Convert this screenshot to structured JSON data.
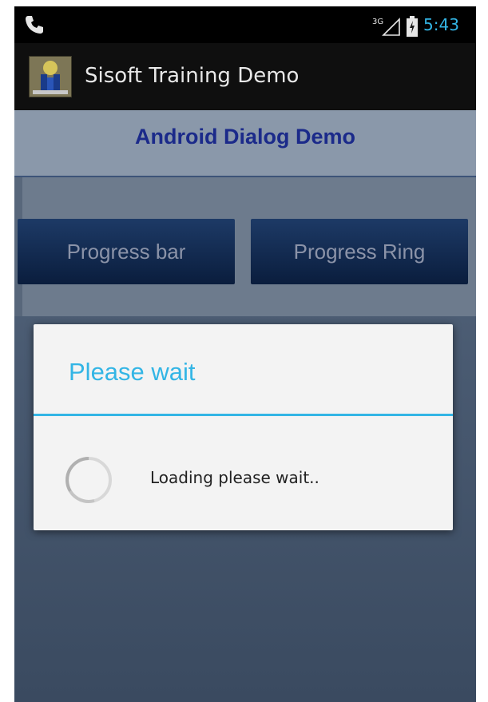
{
  "status_bar": {
    "network_label": "3G",
    "time": "5:43"
  },
  "action_bar": {
    "title": "Sisoft Training Demo"
  },
  "page": {
    "heading": "Android Dialog Demo",
    "buttons": [
      {
        "label": "Progress bar"
      },
      {
        "label": "Progress Ring"
      }
    ]
  },
  "dialog": {
    "title": "Please wait",
    "message": "Loading please wait.."
  },
  "colors": {
    "accent_holo_blue": "#33b5e5",
    "heading_blue": "#1b2a8a"
  }
}
